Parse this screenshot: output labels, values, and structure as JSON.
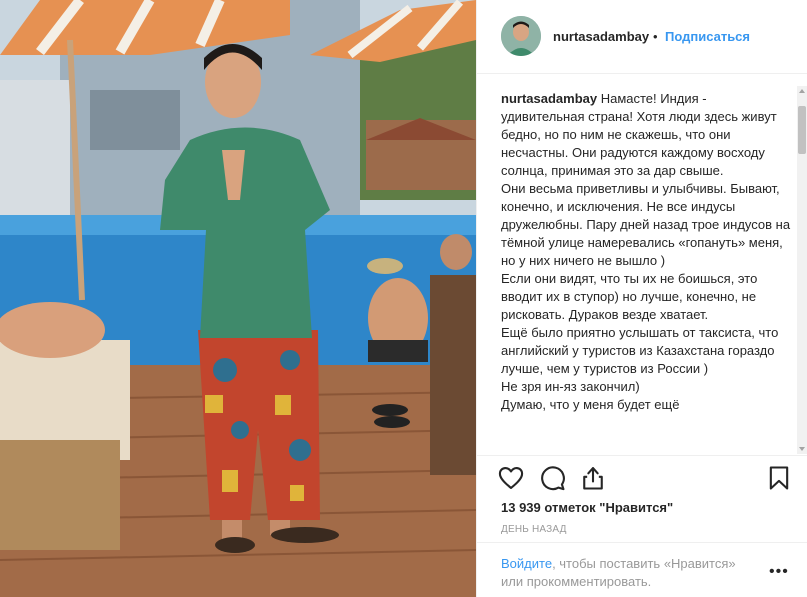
{
  "post": {
    "username": "nurtasadambay",
    "dot": "•",
    "follow_label": "Подписаться"
  },
  "caption": {
    "author": "nurtasadambay",
    "text": " Намасте! Индия - удивительная страна! Хотя люди здесь живут бедно, но по ним не скажешь, что они несчастны. Они радуются каждому восходу солнца, принимая это за дар свыше.\nОни весьма приветливы и улыбчивы. Бывают, конечно, и исключения. Не все индусы дружелюбны. Пару дней назад трое индусов на тёмной улице намеревались «гопануть» меня, но у них ничего не вышло )\nЕсли они видят, что ты их не боишься, это вводит их в ступор) но лучше, конечно, не рисковать. Дураков везде хватает.\nЕщё было приятно услышать от таксиста, что английский у туристов из Казахстана гораздо лучше, чем у туристов из России )\nНе зря ин-яз закончил)\nДумаю, что у меня будет ещё"
  },
  "actions": {
    "like_icon": "heart-icon",
    "comment_icon": "comment-icon",
    "share_icon": "share-icon",
    "save_icon": "bookmark-icon"
  },
  "likes_text": "13 939 отметок \"Нравится\"",
  "time_text": "ДЕНЬ НАЗАД",
  "footer": {
    "login_link": "Войдите",
    "login_rest": ", чтобы поставить «Нравится» или прокомментировать.",
    "more_icon": "•••"
  },
  "colors": {
    "accent": "#3897f0",
    "text": "#262626",
    "muted": "#999999",
    "border": "#efefef"
  }
}
